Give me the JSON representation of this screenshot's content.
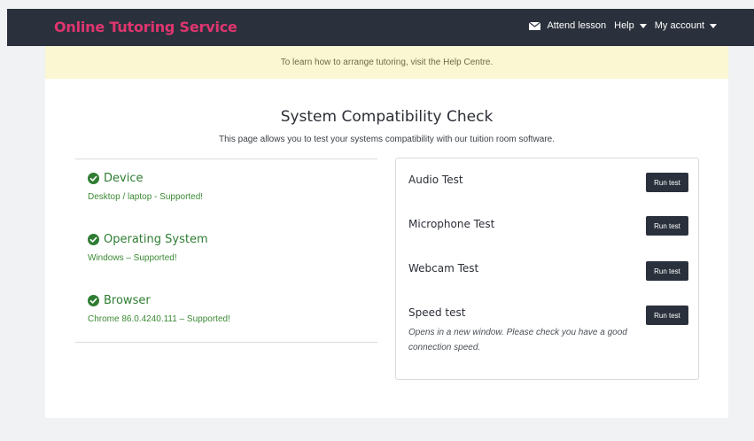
{
  "header": {
    "brand": "Online Tutoring Service",
    "nav": {
      "attend_label": "Attend lesson",
      "help_label": "Help",
      "account_label": "My account"
    }
  },
  "banner": {
    "text": "To learn how to arrange tutoring, visit the Help Centre."
  },
  "main": {
    "title": "System Compatibility Check",
    "subtitle": "This page allows you to test your systems compatibility with our tuition room software."
  },
  "checks": [
    {
      "label": "Device",
      "status": "Desktop / laptop - Supported!"
    },
    {
      "label": "Operating System",
      "status": "Windows – Supported!"
    },
    {
      "label": "Browser",
      "status": "Chrome 86.0.4240.111 – Supported!"
    }
  ],
  "tests": [
    {
      "label": "Audio Test",
      "button": "Run test"
    },
    {
      "label": "Microphone Test",
      "button": "Run test"
    },
    {
      "label": "Webcam Test",
      "button": "Run test"
    },
    {
      "label": "Speed test",
      "button": "Run test",
      "note": "Opens in a new window. Please check you have a good connection speed."
    }
  ],
  "colors": {
    "navbar": "#2a313c",
    "brand": "#e0356f",
    "banner": "#fbf7d2",
    "success": "#2e7d32",
    "button": "#2a313c"
  },
  "icons": {
    "attend": "envelope-icon",
    "check": "check-circle-icon",
    "dropdown": "caret-down-icon"
  }
}
